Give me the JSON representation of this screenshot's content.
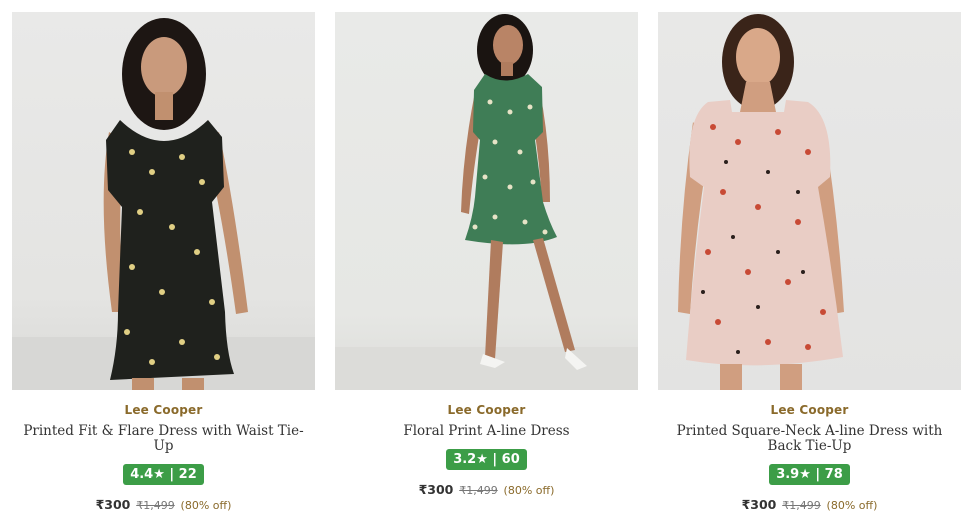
{
  "products": [
    {
      "brand": "Lee Cooper",
      "title": "Printed Fit & Flare Dress with Waist Tie-Up",
      "rating": "4.4★ | 22",
      "price": "₹300",
      "mrp": "₹1,499",
      "discount": "(80% off)",
      "image": "woman in black floral dress"
    },
    {
      "brand": "Lee Cooper",
      "title": "Floral Print A-line Dress",
      "rating": "3.2★ | 60",
      "price": "₹300",
      "mrp": "₹1,499",
      "discount": "(80% off)",
      "image": "woman in green floral dress"
    },
    {
      "brand": "Lee Cooper",
      "title": "Printed Square-Neck A-line Dress with Back Tie-Up",
      "rating": "3.9★ | 78",
      "price": "₹300",
      "mrp": "₹1,499",
      "discount": "(80% off)",
      "image": "woman in pink floral dress"
    }
  ],
  "colors": {
    "brand_text": "#8a6a2b",
    "rating_badge": "#3c9d47",
    "price_text": "#333333"
  }
}
